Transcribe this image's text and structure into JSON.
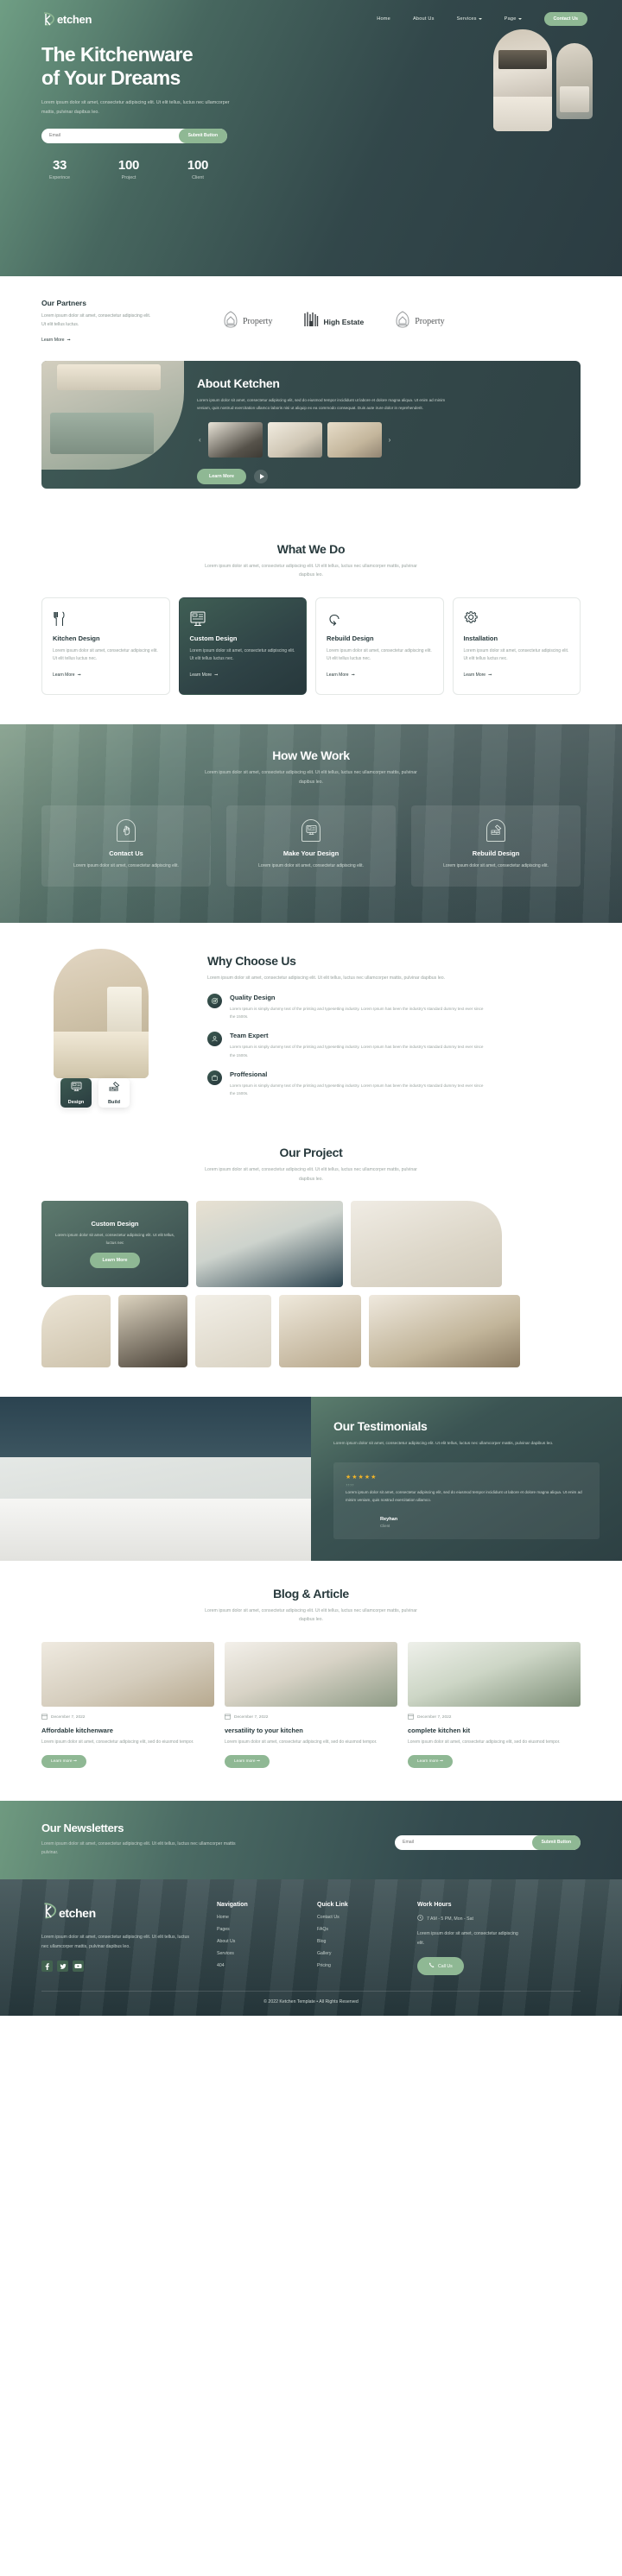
{
  "brand": {
    "name": "etchen",
    "logo_icon": "ketchen-k-logo-icon"
  },
  "nav": {
    "items": [
      {
        "label": "Home",
        "has_caret": false
      },
      {
        "label": "About Us",
        "has_caret": false
      },
      {
        "label": "Services",
        "has_caret": true
      },
      {
        "label": "Page",
        "has_caret": true
      }
    ],
    "cta": "Contact Us"
  },
  "hero": {
    "title_line1": "The Kitchenware",
    "title_line2": "of Your Dreams",
    "subtitle": "Lorem ipsum dolor sit amet, consectetur adipiscing elit. Ut elit tellus, luctus nec ullamcorper mattis, pulvinar dapibus leo.",
    "email_placeholder": "Email",
    "submit_label": "Submit Button",
    "stats": [
      {
        "value": "33",
        "label": "Experince"
      },
      {
        "value": "100",
        "label": "Project"
      },
      {
        "value": "100",
        "label": "Client"
      }
    ]
  },
  "partners": {
    "kicker": "Our Partners",
    "desc": "Lorem ipsum dolor sit amet, consectetur adipiscing elit. Ut elit tellus luctus.",
    "learn_more": "Learn More",
    "logos": [
      {
        "name": "Property",
        "icon": "house-arch-icon",
        "style": "serif"
      },
      {
        "name": "High Estate",
        "icon": "building-columns-icon",
        "style": "bold"
      },
      {
        "name": "Property",
        "icon": "house-arch-icon",
        "style": "serif"
      }
    ]
  },
  "about": {
    "title": "About Ketchen",
    "desc": "Lorem ipsum dolor sit amet, consectetur adipiscing elit, sed do eiusmod tempor incididunt ut labore et dolore magna aliqua. Ut enim ad minim veniam, quis nostrud exercitation ullamco laboris nisi ut aliquip ex ea commodo consequat. Duis aute irure dolor in reprehenderit.",
    "prev": "‹",
    "next": "›",
    "learn_more": "Learn More"
  },
  "whatwedo": {
    "title": "What We Do",
    "desc": "Lorem ipsum dolor sit amet, consectetur adipiscing elit. Ut elit tellus, luctus nec ullamcorper mattis, pulvinar dapibus leo.",
    "cards": [
      {
        "title": "Kitchen Design",
        "desc": "Lorem ipsum dolor sit amet, consectetur adipiscing elit. Ut elit tellus luctus nec.",
        "learn": "Learn More",
        "icon": "fork-knife-icon",
        "active": false
      },
      {
        "title": "Custom Design",
        "desc": "Lorem ipsum dolor sit amet, consectetur adipiscing elit. Ut elit tellus luctus nec.",
        "learn": "Learn More",
        "icon": "monitor-design-icon",
        "active": true
      },
      {
        "title": "Rebuild Design",
        "desc": "Lorem ipsum dolor sit amet, consectetur adipiscing elit. Ut elit tellus luctus nec.",
        "learn": "Learn More",
        "icon": "refresh-arrow-icon",
        "active": false
      },
      {
        "title": "Installation",
        "desc": "Lorem ipsum dolor sit amet, consectetur adipiscing elit. Ut elit tellus luctus nec.",
        "learn": "Learn More",
        "icon": "gear-icon",
        "active": false
      }
    ]
  },
  "howwework": {
    "title": "How We Work",
    "desc": "Lorem ipsum dolor sit amet, consectetur adipiscing elit. Ut elit tellus, luctus nec ullamcorper mattis, pulvinar dapibus leo.",
    "steps": [
      {
        "title": "Contact Us",
        "desc": "Lorem ipsum dolor sit amet, consectetur adipiscing elit.",
        "icon": "hand-contact-icon"
      },
      {
        "title": "Make Your Design",
        "desc": "Lorem ipsum dolor sit amet, consectetur adipiscing elit.",
        "icon": "monitor-design-icon"
      },
      {
        "title": "Rebuild Design",
        "desc": "Lorem ipsum dolor sit amet, consectetur adipiscing elit.",
        "icon": "brick-trowel-icon"
      }
    ]
  },
  "why": {
    "title": "Why Choose Us",
    "desc": "Lorem ipsum dolor sit amet, consectetur adipiscing elit. Ut elit tellus, luctus nec ullamcorper mattis, pulvinar dapibus leo.",
    "features": [
      {
        "title": "Quality Design",
        "desc": "Lorem Ipsum is simply dummy text of the printing and typesetting industry. Lorem Ipsum has been the industry's standard dummy text ever since the 1500s.",
        "icon": "target-badge-icon"
      },
      {
        "title": "Team Expert",
        "desc": "Lorem Ipsum is simply dummy text of the printing and typesetting industry. Lorem Ipsum has been the industry's standard dummy text ever since the 1500s.",
        "icon": "team-badge-icon"
      },
      {
        "title": "Proffesional",
        "desc": "Lorem Ipsum is simply dummy text of the printing and typesetting industry. Lorem Ipsum has been the industry's standard dummy text ever since the 1500s.",
        "icon": "professional-badge-icon"
      }
    ],
    "toggles": [
      {
        "label": "Design",
        "icon": "monitor-design-icon",
        "active": true
      },
      {
        "label": "Build",
        "icon": "brick-trowel-icon",
        "active": false
      }
    ]
  },
  "project": {
    "title": "Our Project",
    "desc": "Lorem ipsum dolor sit amet, consectetur adipiscing elit. Ut elit tellus, luctus nec ullamcorper mattis, pulvinar dapibus leo.",
    "feature": {
      "title": "Custom Design",
      "desc": "Lorem ipsum dolor sit amet, consectetur adipiscing elit. Ut elit tellus, luctus nec",
      "cta": "Learn More"
    }
  },
  "testimonials": {
    "title": "Our Testimonials",
    "desc": "Lorem ipsum dolor sit amet, consectetur adipiscing elit. Ut elit tellus, luctus nec ullamcorper mattis, pulvinar dapibus leo.",
    "rating": "★★★★★",
    "rating_value": 5,
    "quote_mark": "””",
    "quote": "Lorem ipsum dolor sit amet, consectetur adipiscing elit, sed do eiusmod tempor incididunt ut labore et dolore magna aliqua. Ut enim ad minim veniam, quis nostrud exercitation ullamco.",
    "author": "Reyhan",
    "role": "Client"
  },
  "blog": {
    "title": "Blog & Article",
    "desc": "Lorem ipsum dolor sit amet, consectetur adipiscing elit. Ut elit tellus, luctus nec ullamcorper mattis, pulvinar dapibus leo.",
    "posts": [
      {
        "date": "December 7, 2022",
        "title": "Affordable kitchenware",
        "desc": "Lorem ipsum dolor sit amet, consectetur adipiscing elit, sed do eiusmod tempor.",
        "cta": "Learn more"
      },
      {
        "date": "December 7, 2022",
        "title": "versatility to your kitchen",
        "desc": "Lorem ipsum dolor sit amet, consectetur adipiscing elit, sed do eiusmod tempor.",
        "cta": "Learn more"
      },
      {
        "date": "December 7, 2022",
        "title": "complete kitchen kit",
        "desc": "Lorem ipsum dolor sit amet, consectetur adipiscing elit, sed do eiusmod tempor.",
        "cta": "Learn more"
      }
    ]
  },
  "newsletter": {
    "title": "Our Newsletters",
    "desc": "Lorem ipsum dolor sit amet, consectetur adipiscing elit. Ut elit tellus, luctus nec ullamcorper mattis pulvinar.",
    "email_placeholder": "Email",
    "submit_label": "Submit Button"
  },
  "footer": {
    "brand_name": "etchen",
    "desc": "Lorem ipsum dolor sit amet, consectetur adipiscing elit. Ut elit tellus, luctus nec ullamcorper mattis, pulvinar dapibus leo.",
    "socials": [
      {
        "name": "facebook-icon",
        "glyph": "f"
      },
      {
        "name": "twitter-icon",
        "glyph": "ᴛ"
      },
      {
        "name": "youtube-icon",
        "glyph": "▶"
      }
    ],
    "columns": [
      {
        "heading": "Navigation",
        "links": [
          "Home",
          "Pages",
          "About Us",
          "Services",
          "404"
        ]
      },
      {
        "heading": "Quick Link",
        "links": [
          "Contact Us",
          "FAQs",
          "Blog",
          "Gallery",
          "Pricing"
        ]
      }
    ],
    "work_hours": {
      "heading": "Work Hours",
      "hours": "7 AM - 5 PM, Mon - Sat",
      "note": "Lorem ipsum dolor sit amet, consectetur adipiscing elit.",
      "call_label": "Call Us"
    },
    "copyright": "© 2022 Ketchen Template • All Rights Reserved"
  },
  "colors": {
    "accent_green": "#8fb894",
    "dark_teal": "#2d4043",
    "heading": "#27393c",
    "star_gold": "#f0b429"
  }
}
